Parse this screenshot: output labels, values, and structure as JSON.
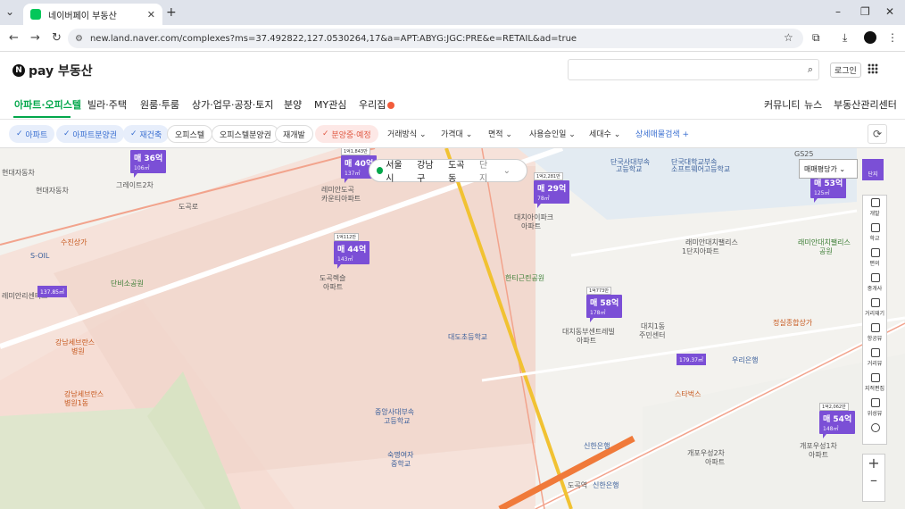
{
  "browser": {
    "tab_title": "네이버페이 부동산",
    "url": "new.land.naver.com/complexes?ms=37.492822,127.0530264,17&a=APT:ABYG:JGC:PRE&e=RETAIL&ad=true"
  },
  "header": {
    "logo_text": "pay 부동산",
    "logo_n": "N",
    "login": "로그인"
  },
  "nav": {
    "items": [
      "아파트·오피스텔",
      "빌라·주택",
      "원룸·투룸",
      "상가·업무·공장·토지",
      "분양",
      "MY관심",
      "우리집"
    ],
    "right": [
      "커뮤니티",
      "뉴스",
      "부동산관리센터"
    ]
  },
  "filters": {
    "chips": [
      "아파트",
      "아파트분양권",
      "재건축",
      "오피스텔",
      "오피스텔분양권",
      "재개발",
      "분양중·예정"
    ],
    "dropdowns": [
      "거래방식",
      "가격대",
      "면적",
      "사용승인일",
      "세대수"
    ],
    "detail": "상세매물검색"
  },
  "location": {
    "city": "서울시",
    "district": "강남구",
    "dong": "도곡동",
    "type": "단지"
  },
  "sort": "매매평당가",
  "danji": "단지",
  "tools": [
    "개발",
    "학교",
    "편의",
    "중개사",
    "거리재기",
    "항공뷰",
    "거리뷰",
    "지적편집",
    "위성뷰"
  ],
  "map_labels": [
    "현대자동차",
    "수진상가",
    "S-OIL",
    "도곡",
    "단비소공원",
    "강남세브란스",
    "병원",
    "강남세브란스",
    "병원1동",
    "레미안도곡",
    "카운티아파트",
    "도곡렉슬",
    "아파트",
    "대치아이파크",
    "아파트",
    "대치동부센트레빌",
    "아파트",
    "대치1동",
    "주민센터",
    "스타벅스",
    "우리은행",
    "정실종합상가",
    "래미안대치팰리스",
    "1단지아파트",
    "래미안대치팰리스",
    "공원",
    "한티근린공원",
    "대도초등학교",
    "중앙사대부속",
    "고등학교",
    "숙명여자",
    "중학교",
    "도곡역",
    "신한은행",
    "개포우성2차",
    "아파트",
    "개포우성1차",
    "아파트",
    "단국사대부속",
    "고등학교",
    "단국대학교부속",
    "소프트웨어고등학교",
    "신한은행",
    "레미안리센티스",
    "그레이트2차"
  ],
  "pins": [
    {
      "price": "매 36억",
      "area": "106㎡"
    },
    {
      "price": "매 40억",
      "area": "137㎡",
      "tag": "1억1,843만"
    },
    {
      "price": "매 44억",
      "area": "143㎡",
      "tag": "1억112만"
    },
    {
      "price": "매 29억",
      "area": "78㎡",
      "tag": "1억2,281만"
    },
    {
      "price": "매 58억",
      "area": "178㎡",
      "tag": "1억773만"
    },
    {
      "price": "매 53억",
      "area": "125㎡"
    },
    {
      "price": "매 54억",
      "area": "148㎡",
      "tag": "1억2,062만"
    }
  ],
  "small_pins": [
    "137.85㎡",
    "179.37㎡"
  ],
  "road_labels": [
    "GS25",
    "도곡로"
  ]
}
